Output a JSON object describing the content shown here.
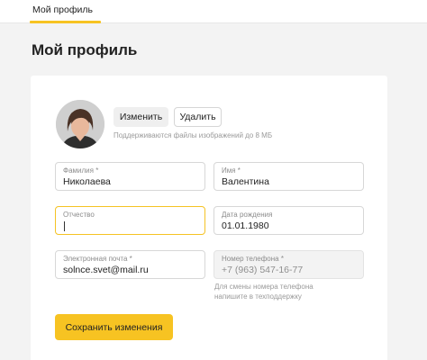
{
  "topnav": {
    "active_tab": "Мой профиль"
  },
  "page": {
    "title": "Мой профиль"
  },
  "photo": {
    "change_label": "Изменить",
    "delete_label": "Удалить",
    "hint": "Поддерживаются файлы изображений до 8 МБ"
  },
  "form": {
    "lastname": {
      "label": "Фамилия *",
      "value": "Николаева"
    },
    "firstname": {
      "label": "Имя *",
      "value": "Валентина"
    },
    "patronymic": {
      "label": "Отчество",
      "value": ""
    },
    "birthdate": {
      "label": "Дата рождения",
      "value": "01.01.1980"
    },
    "email": {
      "label": "Электронная почта *",
      "value": "solnce.svet@mail.ru"
    },
    "phone": {
      "label": "Номер телефона *",
      "value": "+7 (963) 547-16-77",
      "hint": "Для смены номера телефона напишите в техподдержку"
    },
    "save_label": "Сохранить изменения"
  },
  "colors": {
    "accent": "#f7c322",
    "page_bg": "#f3f3f3",
    "card_bg": "#ffffff"
  }
}
